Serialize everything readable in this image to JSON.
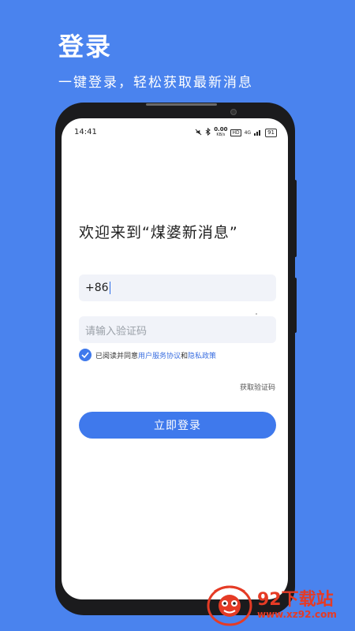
{
  "header": {
    "title": "登录",
    "subtitle": "一键登录，轻松获取最新消息"
  },
  "status_bar": {
    "time": "14:41",
    "speed": "0.00",
    "speed_unit": "KB/s",
    "hd": "HD",
    "network": "4G",
    "battery": "91"
  },
  "login": {
    "welcome": "欢迎来到“煤婆新消息”",
    "phone_value": "+86",
    "code_placeholder": "请输入验证码",
    "agree_prefix": "已阅读并同意",
    "agree_terms": "用户服务协议",
    "agree_and": "和",
    "agree_privacy": "隐私政策",
    "get_code": "获取验证码",
    "login_button": "立即登录"
  },
  "watermark": {
    "title": "92下载站",
    "url": "www.xz92.com"
  },
  "colors": {
    "background": "#4a83ee",
    "accent": "#3f79ec",
    "watermark": "#e53b25"
  }
}
